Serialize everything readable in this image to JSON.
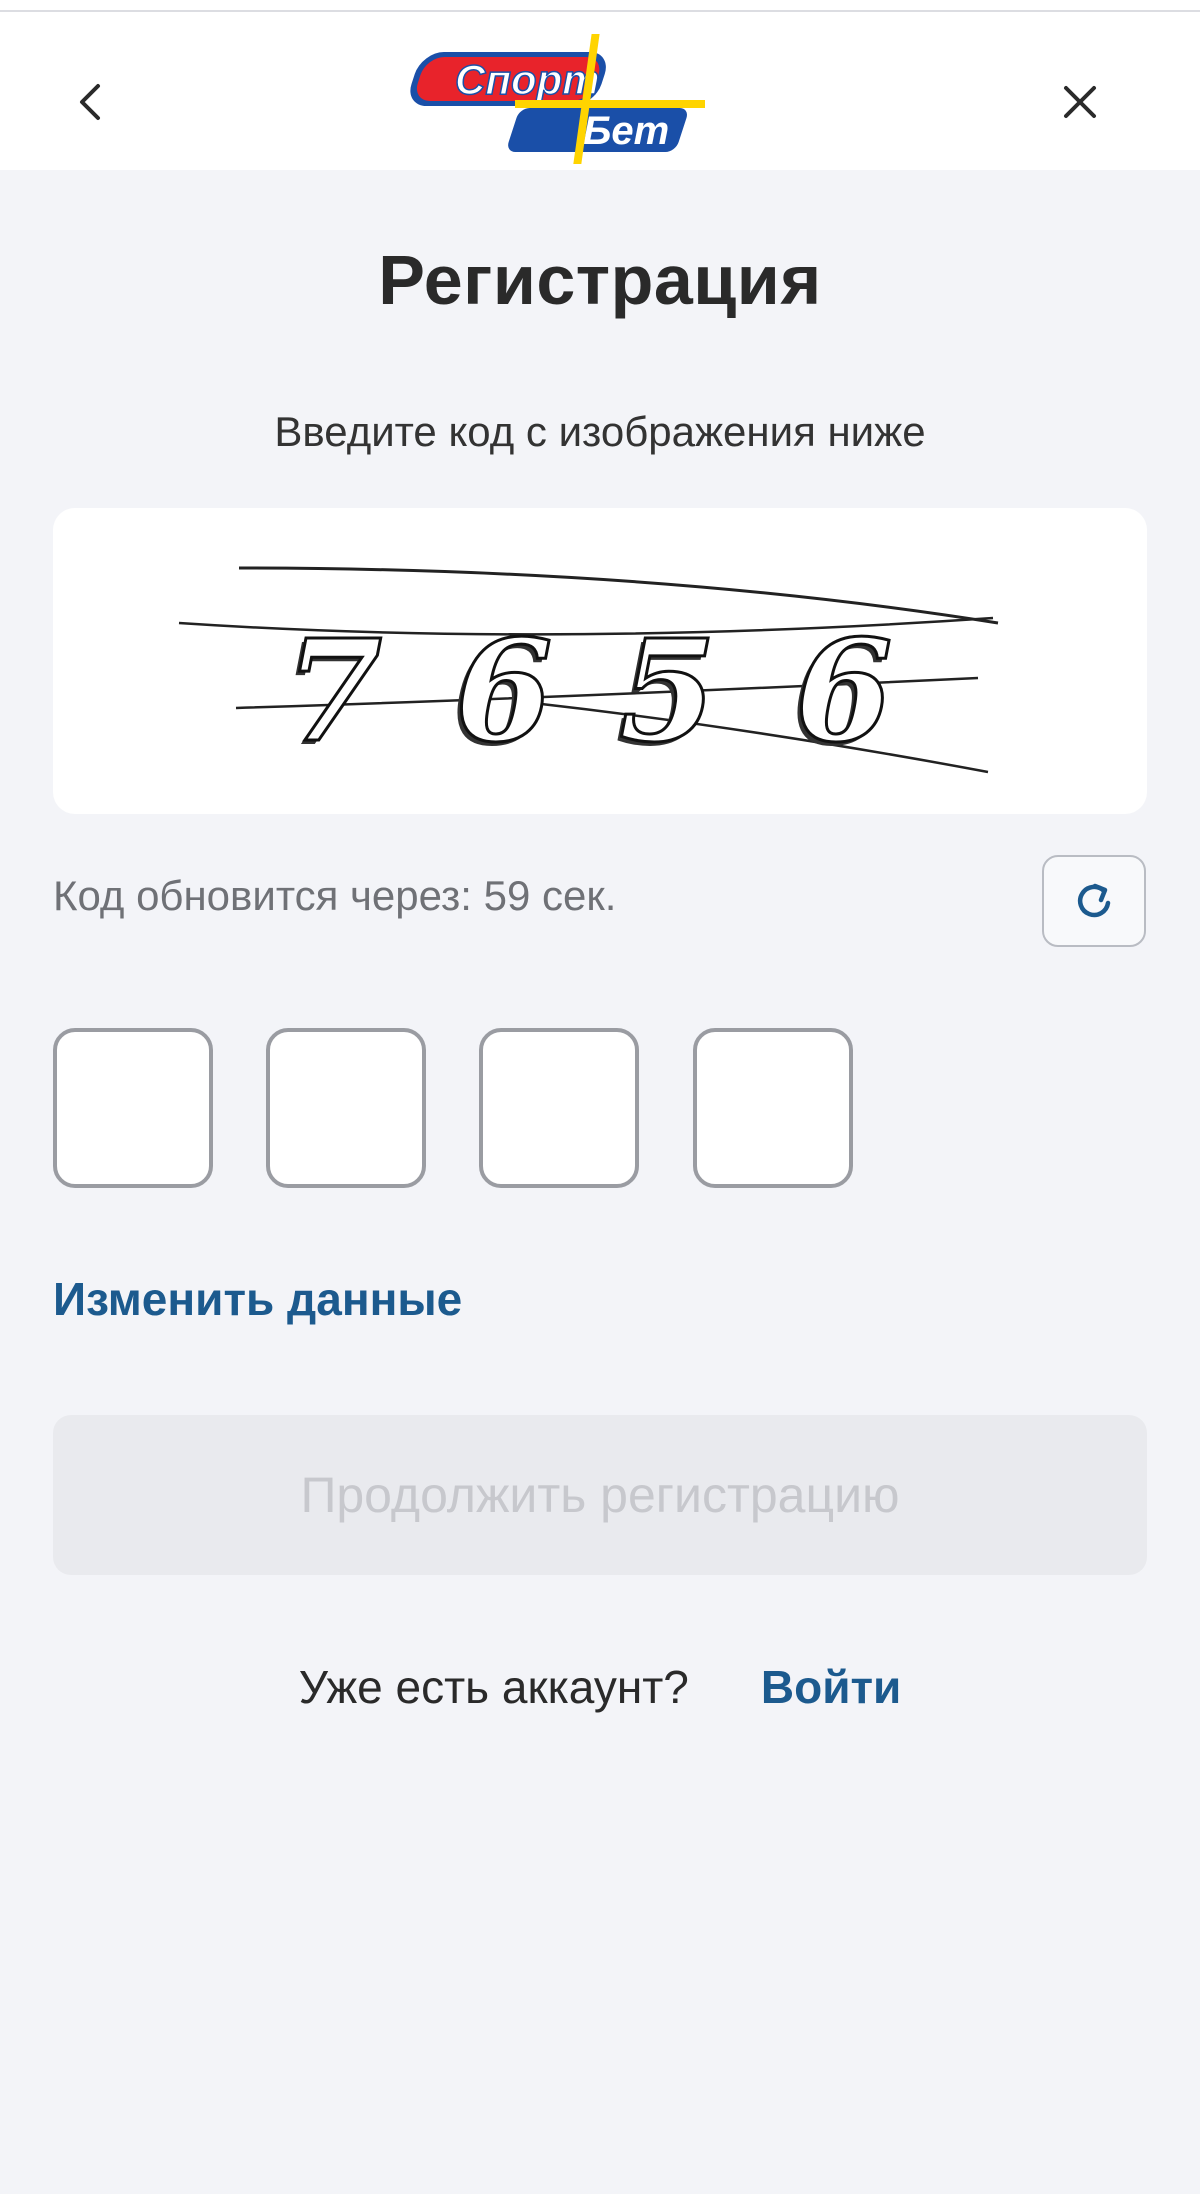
{
  "header": {
    "back_icon": "chevron-left-icon",
    "close_icon": "close-icon",
    "logo": {
      "text": "Спорт Бет",
      "colors": {
        "red": "#e8232b",
        "blue": "#1a4fa8",
        "yellow": "#ffd400"
      }
    }
  },
  "page": {
    "title": "Регистрация",
    "subtitle": "Введите код с изображения ниже"
  },
  "captcha": {
    "digits": [
      "7",
      "6",
      "5",
      "6"
    ]
  },
  "timer": {
    "text": "Код обновится через: 59 сек."
  },
  "refresh": {
    "icon": "refresh-icon",
    "color": "#1c5a8e"
  },
  "code_inputs": [
    {
      "value": ""
    },
    {
      "value": ""
    },
    {
      "value": ""
    },
    {
      "value": ""
    }
  ],
  "links": {
    "change_data": "Изменить данные",
    "already_have_account": "Уже есть аккаунт?",
    "login": "Войти"
  },
  "continue_button": {
    "label": "Продолжить регистрацию",
    "enabled": false
  },
  "colors": {
    "background": "#f3f4f8",
    "accent": "#1c5a8e",
    "disabled_button_bg": "#e9eaee",
    "disabled_button_text": "#c7c8cd"
  }
}
